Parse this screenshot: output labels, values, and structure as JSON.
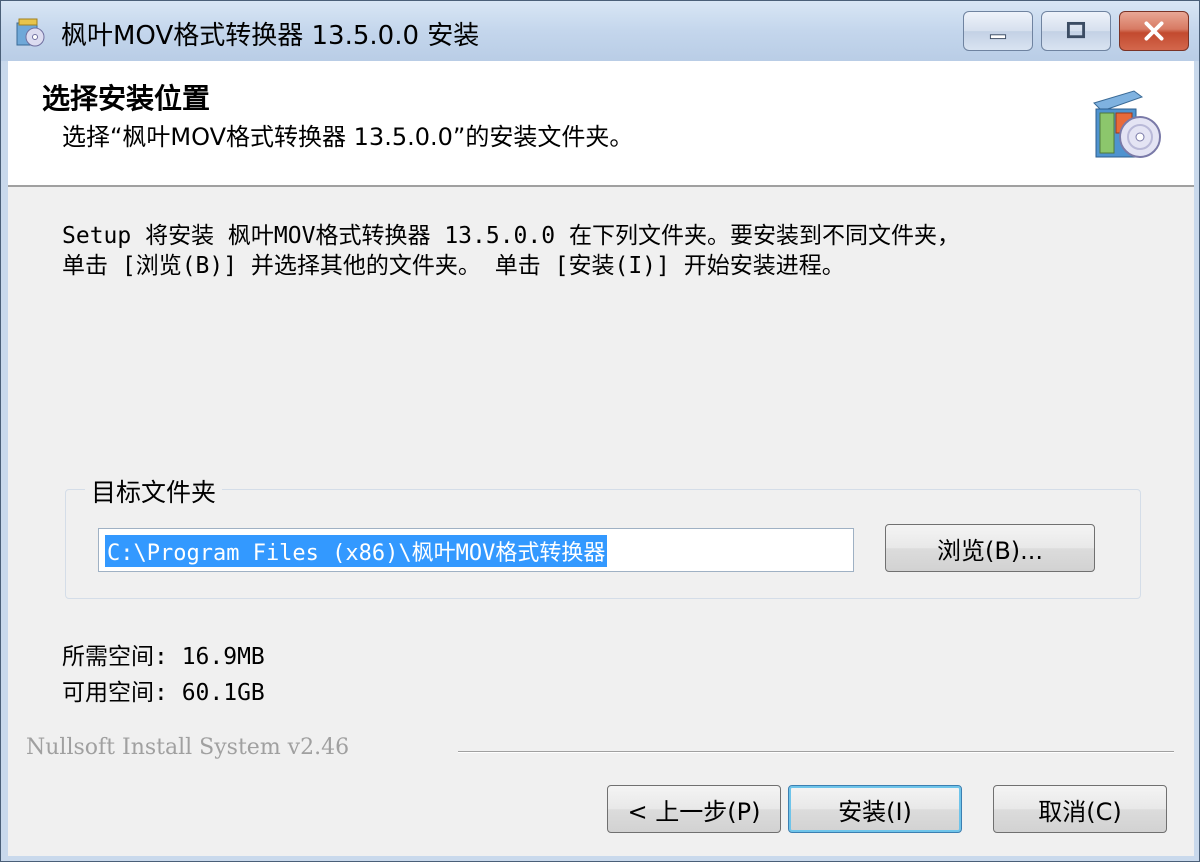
{
  "window": {
    "title": "枫叶MOV格式转换器 13.5.0.0 安装"
  },
  "header": {
    "title": "选择安装位置",
    "subtitle": "选择“枫叶MOV格式转换器 13.5.0.0”的安装文件夹。",
    "icon": "installer-box-cd-icon"
  },
  "body": {
    "intro_line1": "Setup 将安装 枫叶MOV格式转换器 13.5.0.0 在下列文件夹。要安装到不同文件夹，",
    "intro_line2": "单击 [浏览(B)] 并选择其他的文件夹。 单击 [安装(I)] 开始安装进程。",
    "destination": {
      "group_label": "目标文件夹",
      "path": "C:\\Program Files (x86)\\枫叶MOV格式转换器",
      "browse_label": "浏览(B)..."
    },
    "space_required": "所需空间: 16.9MB",
    "space_available": "可用空间: 60.1GB"
  },
  "footer": {
    "branding": "Nullsoft Install System v2.46",
    "back_label": "< 上一步(P)",
    "install_label": "安装(I)",
    "cancel_label": "取消(C)"
  }
}
